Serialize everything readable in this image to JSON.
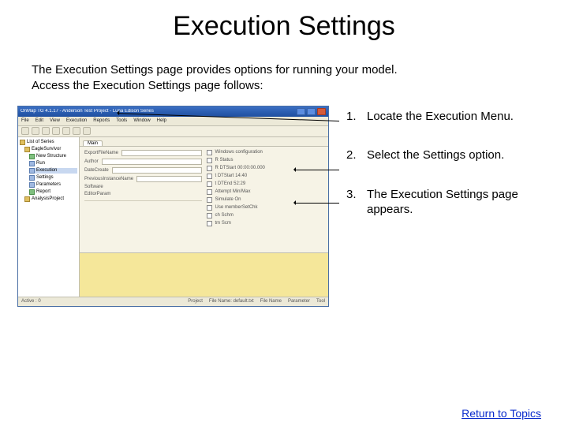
{
  "title": "Execution Settings",
  "intro_line1": "The Execution Settings page provides options for running your model.",
  "intro_line2": "Access the Execution Settings page follows:",
  "screenshot": {
    "title": "OnMap TG 4.1.17 - Anderson Test Project - Luna Edison Series",
    "menus": [
      "File",
      "Edit",
      "View",
      "Execution",
      "Reports",
      "Tools",
      "Window",
      "Help"
    ],
    "tree": [
      {
        "label": "List of Series",
        "icon": "a"
      },
      {
        "label": "EagleSurvivor",
        "icon": "a",
        "indent": 1
      },
      {
        "label": "New Structure",
        "icon": "b",
        "indent": 2
      },
      {
        "label": "Run",
        "icon": "c",
        "indent": 2
      },
      {
        "label": "Execution",
        "icon": "c",
        "indent": 2,
        "sel": true
      },
      {
        "label": "Settings",
        "icon": "c",
        "indent": 2
      },
      {
        "label": "Parameters",
        "icon": "c",
        "indent": 2
      },
      {
        "label": "Report",
        "icon": "b",
        "indent": 2
      },
      {
        "label": "AnalysisProject",
        "icon": "a",
        "indent": 1
      }
    ],
    "tabs": [
      "Main"
    ],
    "left_fields": [
      {
        "label": "ExportFileName",
        "type": "input"
      },
      {
        "label": "Author",
        "type": "input"
      },
      {
        "label": "DateCreate",
        "type": "input"
      },
      {
        "label": "PreviousInstanceName",
        "type": "input"
      },
      {
        "label": "Software",
        "type": "text"
      },
      {
        "label": "EditorParam",
        "type": "text"
      }
    ],
    "right_fields": [
      {
        "label": "Windows configuration"
      },
      {
        "label": "R Status"
      },
      {
        "label": "R DTStart",
        "value": "00:00:00.000"
      },
      {
        "label": "t DTStart",
        "value": "14:40"
      },
      {
        "label": "t DTEnd",
        "value": "52:29"
      },
      {
        "label": "Attempt Min/Max"
      },
      {
        "label": "Simulate On"
      },
      {
        "label": "Use memberSetChk"
      },
      {
        "label": "ch Schm"
      },
      {
        "label": "tm Scm"
      }
    ],
    "status_left": "Active : 0",
    "status_items": [
      "Project",
      "File Name: default.txt",
      "File Name",
      "Parameter",
      "Tool"
    ]
  },
  "steps": [
    {
      "num": "1.",
      "text": "Locate the Execution Menu."
    },
    {
      "num": "2.",
      "text": "Select the Settings option."
    },
    {
      "num": "3.",
      "text": "The Execution Settings page appears."
    }
  ],
  "return_link": "Return to Topics"
}
